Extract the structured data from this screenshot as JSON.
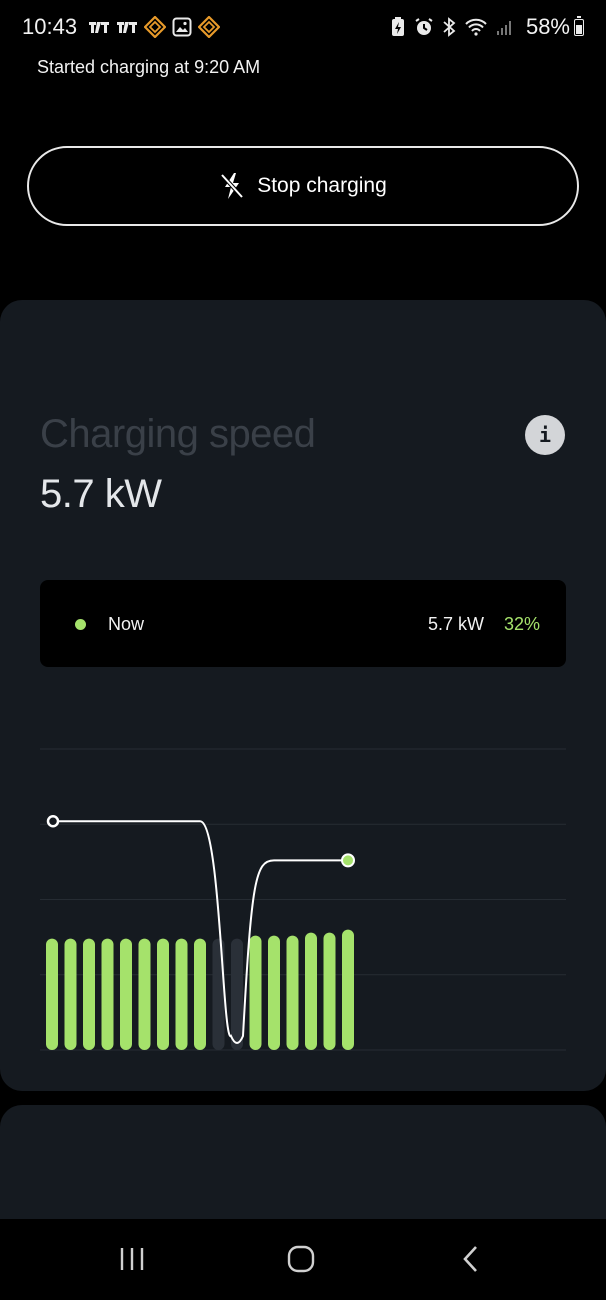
{
  "status_bar": {
    "time": "10:43",
    "battery_percent": "58%",
    "battery_level": 0.58,
    "left_icons": [
      "tradingview-icon",
      "tradingview-icon",
      "rivian-icon",
      "gallery-icon",
      "rivian-icon"
    ],
    "right_icons": [
      "battery-saver-icon",
      "alarm-icon",
      "bluetooth-icon",
      "wifi-icon",
      "signal-icon"
    ]
  },
  "header": {
    "subtitle": "Started charging at 9:20 AM"
  },
  "stop_button": {
    "label": "Stop charging",
    "icon": "stop-charging-icon"
  },
  "speed_card": {
    "title": "Charging speed",
    "value": "5.7 kW",
    "info_label": "i",
    "legend": {
      "label": "Now",
      "value": "5.7 kW",
      "percent": "32%"
    }
  },
  "colors": {
    "accent_green": "#a5e26b",
    "card_bg": "#151a20",
    "background": "#000000"
  },
  "chart_data": {
    "type": "bar",
    "bars": [
      {
        "level": 0.37,
        "active": true
      },
      {
        "level": 0.37,
        "active": true
      },
      {
        "level": 0.37,
        "active": true
      },
      {
        "level": 0.37,
        "active": true
      },
      {
        "level": 0.37,
        "active": true
      },
      {
        "level": 0.37,
        "active": true
      },
      {
        "level": 0.37,
        "active": true
      },
      {
        "level": 0.37,
        "active": true
      },
      {
        "level": 0.37,
        "active": true
      },
      {
        "level": 0.37,
        "active": false
      },
      {
        "level": 0.37,
        "active": false
      },
      {
        "level": 0.38,
        "active": true
      },
      {
        "level": 0.38,
        "active": true
      },
      {
        "level": 0.38,
        "active": true
      },
      {
        "level": 0.39,
        "active": true
      },
      {
        "level": 0.39,
        "active": true
      },
      {
        "level": 0.4,
        "active": true
      }
    ],
    "line": [
      0.76,
      0.76,
      0.76,
      0.76,
      0.76,
      0.76,
      0.76,
      0.76,
      0.76,
      0.6,
      0.02,
      0.55,
      0.63,
      0.63,
      0.63,
      0.63,
      0.63
    ],
    "gridlines": 5
  },
  "nav_bar": {
    "recent_icon": "recent-apps-icon",
    "home_icon": "home-icon",
    "back_icon": "back-icon"
  }
}
